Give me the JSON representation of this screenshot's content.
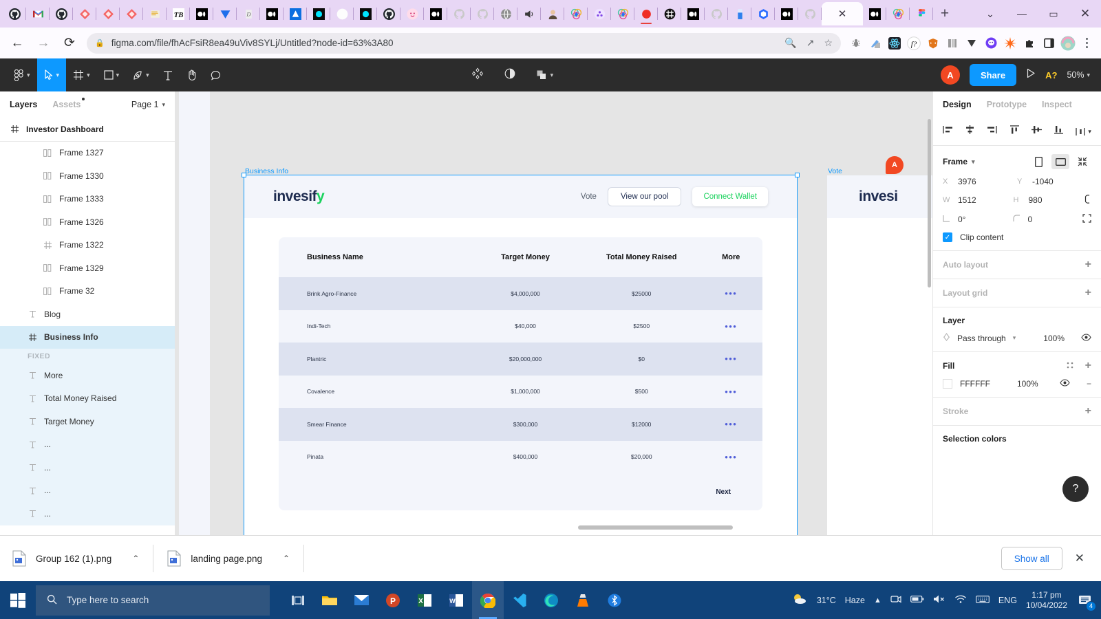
{
  "browser": {
    "url": "figma.com/file/fhAcFsiR8ea49uViv8SYLj/Untitled?node-id=63%3A80",
    "back_icon": "back-arrow-icon",
    "forward_icon": "forward-arrow-icon",
    "reload_icon": "reload-icon",
    "lock_icon": "lock-icon",
    "tabs": [
      {
        "name": "github",
        "color": "#24292f",
        "glyph": "github"
      },
      {
        "name": "gmail",
        "color": "#ea4335",
        "glyph": "gmail"
      },
      {
        "name": "github",
        "color": "#24292f",
        "glyph": "github"
      },
      {
        "name": "bitbucket",
        "color": "#f15c5c",
        "glyph": "diamond"
      },
      {
        "name": "bitbucket",
        "color": "#f15c5c",
        "glyph": "diamond"
      },
      {
        "name": "bitbucket",
        "color": "#f15c5c",
        "glyph": "diamond"
      },
      {
        "name": "doc",
        "color": "#e8c87a",
        "glyph": "doc"
      },
      {
        "name": "tb",
        "color": "#111111",
        "glyph": "tb"
      },
      {
        "name": "medium",
        "color": "#000000",
        "glyph": "medium"
      },
      {
        "name": "vercel",
        "color": "#1f6feb",
        "glyph": "triangle"
      },
      {
        "name": "script",
        "color": "#888888",
        "glyph": "script"
      },
      {
        "name": "medium",
        "color": "#000000",
        "glyph": "medium"
      },
      {
        "name": "alchemy",
        "color": "#1f6feb",
        "glyph": "alchemy"
      },
      {
        "name": "ethereum-dark",
        "color": "#00e5ff",
        "glyph": "circledark"
      },
      {
        "name": "blank",
        "color": "#ffffff",
        "glyph": "blank"
      },
      {
        "name": "ethereum-dark",
        "color": "#00e5ff",
        "glyph": "circledark"
      },
      {
        "name": "github",
        "color": "#24292f",
        "glyph": "github"
      },
      {
        "name": "pinky",
        "color": "#ff9ecb",
        "glyph": "pink"
      },
      {
        "name": "medium",
        "color": "#000000",
        "glyph": "medium"
      },
      {
        "name": "github-white",
        "color": "#ffffff",
        "glyph": "githubw"
      },
      {
        "name": "github-white",
        "color": "#ffffff",
        "glyph": "githubw"
      },
      {
        "name": "globe",
        "color": "#7a7a7a",
        "glyph": "globe"
      },
      {
        "name": "speaker",
        "color": "#444444",
        "glyph": "speaker"
      },
      {
        "name": "person",
        "color": "#9a6b4f",
        "glyph": "person"
      },
      {
        "name": "rainbow",
        "color": "#e04f9a",
        "glyph": "rainbow"
      },
      {
        "name": "polygon",
        "color": "#8247e5",
        "glyph": "polygon"
      },
      {
        "name": "rainbow",
        "color": "#e04f9a",
        "glyph": "rainbow"
      },
      {
        "name": "recording",
        "color": "#e8403a",
        "glyph": "record"
      },
      {
        "name": "hashnode",
        "color": "#111111",
        "glyph": "hash"
      },
      {
        "name": "medium",
        "color": "#000000",
        "glyph": "medium"
      },
      {
        "name": "github-white",
        "color": "#ffffff",
        "glyph": "githubw"
      },
      {
        "name": "battery",
        "color": "#2f80ed",
        "glyph": "batt"
      },
      {
        "name": "hexagon",
        "color": "#2b6cff",
        "glyph": "hex"
      },
      {
        "name": "medium",
        "color": "#000000",
        "glyph": "medium"
      },
      {
        "name": "github-white",
        "color": "#ffffff",
        "glyph": "githubw"
      },
      {
        "name": "figma-active",
        "color": "#0d99ff",
        "glyph": "close"
      },
      {
        "name": "medium",
        "color": "#000000",
        "glyph": "medium"
      },
      {
        "name": "rainbow",
        "color": "#e04f9a",
        "glyph": "rainbow"
      },
      {
        "name": "figma",
        "color": "#f24e1e",
        "glyph": "figma"
      }
    ],
    "newtab_label": "+",
    "window_controls": {
      "minimize": "—",
      "maximize": "▭",
      "close": "✕",
      "chevron": "⌄"
    },
    "omnibox_actions": [
      "search-icon",
      "share-icon",
      "bookmark-star-icon"
    ],
    "extensions": [
      "bug-icon",
      "eyedropper-icon",
      "react-devtools-icon",
      "fonts-ninja-icon",
      "metamask-icon",
      "reading-list-icon",
      "vercel-icon",
      "phantom-icon",
      "starburst-icon",
      "puzzle-icon",
      "sidepanel-icon",
      "profile-avatar-icon",
      "chrome-menu-icon"
    ]
  },
  "figma": {
    "toolbar": {
      "menu_icon": "figma-logo-icon",
      "tools": [
        "move-tool-icon",
        "frame-tool-icon",
        "shape-tool-icon",
        "pen-tool-icon",
        "text-tool-icon",
        "hand-tool-icon",
        "comment-tool-icon"
      ],
      "center": [
        "components-icon",
        "mask-icon",
        "boolean-icon"
      ],
      "avatar_initial": "A",
      "share_label": "Share",
      "present_icon": "play-icon",
      "font_label": "A?",
      "zoom_label": "50%"
    },
    "left_panel": {
      "tabs": [
        {
          "label": "Layers",
          "active": true
        },
        {
          "label": "Assets",
          "active": false
        }
      ],
      "page_label": "Page 1",
      "root_layer": {
        "label": "Investor Dashboard",
        "icon": "frame-icon"
      },
      "layers": [
        {
          "label": "Frame 1327",
          "icon": "component-icon",
          "indent": 1,
          "selected": false
        },
        {
          "label": "Frame 1330",
          "icon": "component-icon",
          "indent": 1,
          "selected": false
        },
        {
          "label": "Frame 1333",
          "icon": "component-icon",
          "indent": 1,
          "selected": false
        },
        {
          "label": "Frame 1326",
          "icon": "component-icon",
          "indent": 1,
          "selected": false
        },
        {
          "label": "Frame 1322",
          "icon": "frame-icon",
          "indent": 1,
          "selected": false
        },
        {
          "label": "Frame 1329",
          "icon": "component-icon",
          "indent": 1,
          "selected": false
        },
        {
          "label": "Frame 32",
          "icon": "component-icon",
          "indent": 1,
          "selected": false
        },
        {
          "label": "Blog",
          "icon": "text-icon",
          "indent": 0,
          "selected": false
        },
        {
          "label": "Business Info",
          "icon": "frame-icon",
          "indent": 0,
          "selected": true
        }
      ],
      "fixed_label": "FIXED",
      "fixed_layers": [
        {
          "label": "More",
          "icon": "text-icon"
        },
        {
          "label": "Total Money Raised",
          "icon": "text-icon"
        },
        {
          "label": "Target Money",
          "icon": "text-icon"
        },
        {
          "label": "...",
          "icon": "text-icon"
        },
        {
          "label": "...",
          "icon": "text-icon"
        },
        {
          "label": "...",
          "icon": "text-icon"
        },
        {
          "label": "...",
          "icon": "text-icon"
        }
      ]
    },
    "canvas": {
      "frame_label": "Business Info",
      "frame2_label": "Vote",
      "comment_avatar": "A",
      "site": {
        "logo_main": "invesif",
        "logo_accent": "y",
        "nav_vote": "Vote",
        "btn_view_pool": "View our pool",
        "btn_connect_wallet": "Connect Wallet",
        "accent_green": "#19d25c"
      },
      "table": {
        "columns": [
          "Business Name",
          "Target Money",
          "Total Money Raised",
          "More"
        ],
        "rows": [
          {
            "name": "Brink Agro-Finance",
            "target": "$4,000,000",
            "raised": "$25000",
            "more": "•••"
          },
          {
            "name": "Indi-Tech",
            "target": "$40,000",
            "raised": "$2500",
            "more": "•••"
          },
          {
            "name": "Plantric",
            "target": "$20,000,000",
            "raised": "$0",
            "more": "•••"
          },
          {
            "name": "Covalence",
            "target": "$1,000,000",
            "raised": "$500",
            "more": "•••"
          },
          {
            "name": "Smear Finance",
            "target": "$300,000",
            "raised": "$12000",
            "more": "•••"
          },
          {
            "name": "Pinata",
            "target": "$400,000",
            "raised": "$20,000",
            "more": "•••"
          }
        ],
        "next_label": "Next"
      },
      "frame2_logo": "invesi"
    },
    "right_panel": {
      "tabs": [
        {
          "label": "Design",
          "active": true
        },
        {
          "label": "Prototype",
          "active": false
        },
        {
          "label": "Inspect",
          "active": false
        }
      ],
      "align_icons": [
        "align-left-icon",
        "align-horizontal-center-icon",
        "align-right-icon",
        "align-top-icon",
        "align-vertical-center-icon",
        "align-bottom-icon",
        "distribute-icon"
      ],
      "frame": {
        "type_label": "Frame",
        "x_key": "X",
        "x_value": "3976",
        "y_key": "Y",
        "y_value": "-1040",
        "w_key": "W",
        "w_value": "1512",
        "h_key": "H",
        "h_value": "980",
        "rotation_value": "0°",
        "corner_value": "0",
        "clip_content_label": "Clip content",
        "clip_content_checked": true
      },
      "auto_layout_label": "Auto layout",
      "layout_grid_label": "Layout grid",
      "layer": {
        "title": "Layer",
        "blend_mode": "Pass through",
        "opacity": "100%",
        "visible_icon": "eye-icon"
      },
      "fill": {
        "title": "Fill",
        "hex": "FFFFFF",
        "opacity": "100%",
        "visible_icon": "eye-icon",
        "remove_icon": "minus-icon"
      },
      "stroke_label": "Stroke",
      "selection_colors_label": "Selection colors",
      "help_label": "?"
    }
  },
  "downloads": {
    "items": [
      {
        "name": "Group 162 (1).png",
        "chevron": "⌃"
      },
      {
        "name": "landing page.png",
        "chevron": "⌃"
      }
    ],
    "show_all_label": "Show all",
    "close_label": "✕"
  },
  "taskbar": {
    "search_placeholder": "Type here to search",
    "start_icon": "windows-start-icon",
    "apps": [
      "task-view-icon",
      "file-explorer-icon",
      "mail-icon",
      "powerpoint-icon",
      "excel-icon",
      "word-icon",
      "chrome-icon",
      "vscode-icon",
      "edge-icon",
      "vlc-icon",
      "bluetooth-icon"
    ],
    "weather_temp": "31°C",
    "weather_desc": "Haze",
    "tray_icons": [
      "show-hidden-icons-chevron",
      "camera-icon",
      "battery-icon",
      "volume-muted-icon",
      "wifi-icon",
      "keyboard-icon"
    ],
    "language": "ENG",
    "time": "1:17 pm",
    "date": "10/04/2022",
    "notification_count": "4"
  }
}
